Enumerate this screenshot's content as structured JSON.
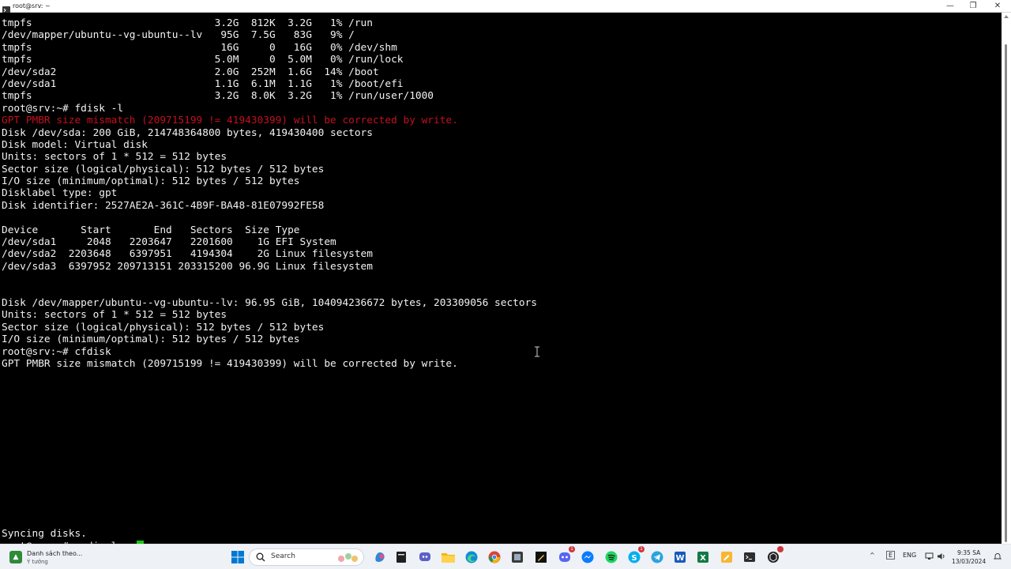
{
  "window": {
    "title": "root@srv: ~",
    "minimize_glyph": "—",
    "maximize_glyph": "❐",
    "close_glyph": "✕"
  },
  "terminal": {
    "lines": [
      {
        "text": "tmpfs                              3.2G  812K  3.2G   1% /run",
        "error": false
      },
      {
        "text": "/dev/mapper/ubuntu--vg-ubuntu--lv   95G  7.5G   83G   9% /",
        "error": false
      },
      {
        "text": "tmpfs                               16G     0   16G   0% /dev/shm",
        "error": false
      },
      {
        "text": "tmpfs                              5.0M     0  5.0M   0% /run/lock",
        "error": false
      },
      {
        "text": "/dev/sda2                          2.0G  252M  1.6G  14% /boot",
        "error": false
      },
      {
        "text": "/dev/sda1                          1.1G  6.1M  1.1G   1% /boot/efi",
        "error": false
      },
      {
        "text": "tmpfs                              3.2G  8.0K  3.2G   1% /run/user/1000",
        "error": false
      },
      {
        "text": "root@srv:~# fdisk -l",
        "error": false
      },
      {
        "text": "GPT PMBR size mismatch (209715199 != 419430399) will be corrected by write.",
        "error": true
      },
      {
        "text": "Disk /dev/sda: 200 GiB, 214748364800 bytes, 419430400 sectors",
        "error": false
      },
      {
        "text": "Disk model: Virtual disk",
        "error": false
      },
      {
        "text": "Units: sectors of 1 * 512 = 512 bytes",
        "error": false
      },
      {
        "text": "Sector size (logical/physical): 512 bytes / 512 bytes",
        "error": false
      },
      {
        "text": "I/O size (minimum/optimal): 512 bytes / 512 bytes",
        "error": false
      },
      {
        "text": "Disklabel type: gpt",
        "error": false
      },
      {
        "text": "Disk identifier: 2527AE2A-361C-4B9F-BA48-81E07992FE58",
        "error": false
      },
      {
        "text": "",
        "error": false
      },
      {
        "text": "Device       Start       End   Sectors  Size Type",
        "error": false
      },
      {
        "text": "/dev/sda1     2048   2203647   2201600    1G EFI System",
        "error": false
      },
      {
        "text": "/dev/sda2  2203648   6397951   4194304    2G Linux filesystem",
        "error": false
      },
      {
        "text": "/dev/sda3  6397952 209713151 203315200 96.9G Linux filesystem",
        "error": false
      },
      {
        "text": "",
        "error": false
      },
      {
        "text": "",
        "error": false
      },
      {
        "text": "Disk /dev/mapper/ubuntu--vg-ubuntu--lv: 96.95 GiB, 104094236672 bytes, 203309056 sectors",
        "error": false
      },
      {
        "text": "Units: sectors of 1 * 512 = 512 bytes",
        "error": false
      },
      {
        "text": "Sector size (logical/physical): 512 bytes / 512 bytes",
        "error": false
      },
      {
        "text": "I/O size (minimum/optimal): 512 bytes / 512 bytes",
        "error": false
      },
      {
        "text": "root@srv:~# cfdisk",
        "error": false
      },
      {
        "text": "GPT PMBR size mismatch (209715199 != 419430399) will be corrected by write.",
        "error": false
      },
      {
        "text": "",
        "error": false
      },
      {
        "text": "",
        "error": false
      },
      {
        "text": "",
        "error": false
      },
      {
        "text": "",
        "error": false
      },
      {
        "text": "",
        "error": false
      },
      {
        "text": "",
        "error": false
      },
      {
        "text": "",
        "error": false
      },
      {
        "text": "",
        "error": false
      },
      {
        "text": "",
        "error": false
      },
      {
        "text": "",
        "error": false
      },
      {
        "text": "",
        "error": false
      },
      {
        "text": "",
        "error": false
      },
      {
        "text": "",
        "error": false
      },
      {
        "text": "Syncing disks.",
        "error": false
      },
      {
        "text": "root@srv:~# pvdisplay ",
        "error": false,
        "is_input": true
      }
    ]
  },
  "taskbar": {
    "widget": {
      "line1": "Danh sách theo...",
      "line2": "Ý tưởng",
      "icon": "stock-widget-icon"
    },
    "search_placeholder": "Search",
    "icons": [
      {
        "name": "start-icon"
      },
      {
        "name": "copilot-icon"
      },
      {
        "name": "file-icon"
      },
      {
        "name": "chat-icon"
      },
      {
        "name": "folder-icon"
      },
      {
        "name": "edge-icon"
      },
      {
        "name": "chrome-icon"
      },
      {
        "name": "app-icon"
      },
      {
        "name": "notepad-icon"
      },
      {
        "name": "discord-icon",
        "badge": "1"
      },
      {
        "name": "messenger-icon"
      },
      {
        "name": "spotify-icon"
      },
      {
        "name": "skype-icon",
        "badge": "1"
      },
      {
        "name": "telegram-icon"
      },
      {
        "name": "word-icon"
      },
      {
        "name": "excel-icon"
      },
      {
        "name": "note-icon"
      },
      {
        "name": "terminal-icon"
      },
      {
        "name": "chatgpt-icon",
        "badge": ""
      }
    ],
    "tray": {
      "chevron": "^",
      "keyboard": "E",
      "language": "ENG",
      "time": "9:35 SA",
      "date": "13/03/2024"
    }
  }
}
